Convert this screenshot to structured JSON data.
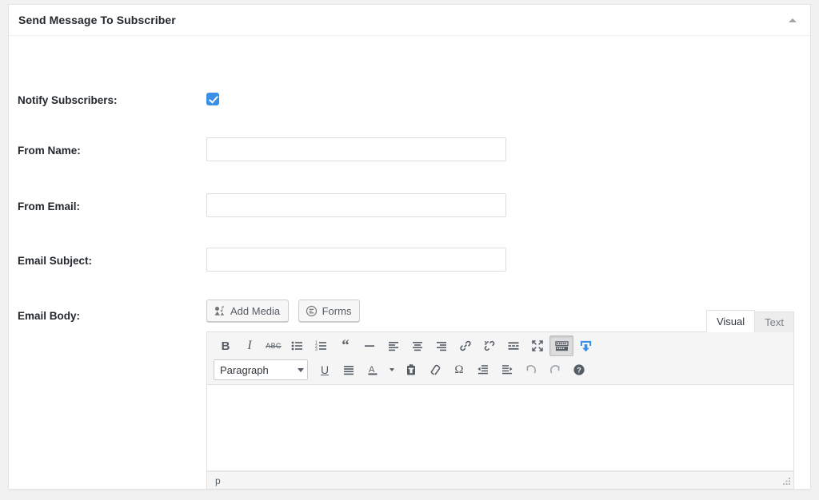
{
  "panel": {
    "title": "Send Message To Subscriber",
    "toggle_icon": "caret-up-icon"
  },
  "form": {
    "rows": [
      {
        "label": "Notify Subscribers:",
        "type": "checkbox",
        "checked": true
      },
      {
        "label": "From Name:",
        "type": "text",
        "value": "",
        "placeholder": ""
      },
      {
        "label": "From Email:",
        "type": "text",
        "value": "",
        "placeholder": ""
      },
      {
        "label": "Email Subject:",
        "type": "text",
        "value": "",
        "placeholder": ""
      },
      {
        "label": "Email Body:",
        "type": "editor"
      }
    ]
  },
  "editor": {
    "media_buttons": [
      {
        "label": "Add Media",
        "icon": "add-media-icon"
      },
      {
        "label": "Forms",
        "icon": "forms-icon"
      }
    ],
    "tabs": [
      {
        "label": "Visual",
        "active": true
      },
      {
        "label": "Text",
        "active": false
      }
    ],
    "toolbar_row1": [
      {
        "name": "bold",
        "glyph": "B"
      },
      {
        "name": "italic",
        "glyph": "I"
      },
      {
        "name": "strikethrough",
        "glyph": "ABC"
      },
      {
        "name": "bullet-list",
        "glyph": ""
      },
      {
        "name": "numbered-list",
        "glyph": ""
      },
      {
        "name": "blockquote",
        "glyph": "“"
      },
      {
        "name": "horizontal-rule",
        "glyph": "—"
      },
      {
        "name": "align-left",
        "glyph": ""
      },
      {
        "name": "align-center",
        "glyph": ""
      },
      {
        "name": "align-right",
        "glyph": ""
      },
      {
        "name": "insert-link",
        "glyph": ""
      },
      {
        "name": "remove-link",
        "glyph": ""
      },
      {
        "name": "insert-read-more",
        "glyph": ""
      },
      {
        "name": "fullscreen",
        "glyph": ""
      },
      {
        "name": "toggle-toolbar",
        "glyph": "",
        "active": true
      },
      {
        "name": "insert-shortcode",
        "glyph": ""
      }
    ],
    "toolbar_row2": [
      {
        "name": "paragraph-format",
        "label": "Paragraph"
      },
      {
        "name": "underline",
        "glyph": "U"
      },
      {
        "name": "align-justify",
        "glyph": ""
      },
      {
        "name": "text-color",
        "glyph": "A"
      },
      {
        "name": "text-color-picker",
        "glyph": ""
      },
      {
        "name": "paste-as-text",
        "glyph": ""
      },
      {
        "name": "clear-formatting",
        "glyph": ""
      },
      {
        "name": "special-character",
        "glyph": "Ω"
      },
      {
        "name": "outdent",
        "glyph": ""
      },
      {
        "name": "indent",
        "glyph": ""
      },
      {
        "name": "undo",
        "glyph": ""
      },
      {
        "name": "redo",
        "glyph": ""
      },
      {
        "name": "keyboard-shortcuts-help",
        "glyph": "?"
      }
    ],
    "content": "",
    "status_path": "p"
  },
  "colors": {
    "accent_blue": "#3a8fe8",
    "panel_border": "#e5e5e5",
    "toolbar_bg": "#f5f5f5",
    "text": "#23282d"
  }
}
